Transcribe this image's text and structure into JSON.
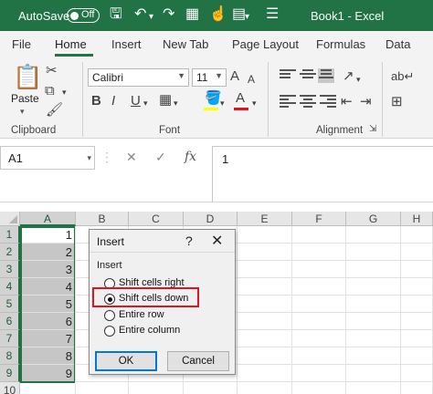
{
  "titlebar": {
    "autosave_label": "AutoSave",
    "autosave_state": "Off",
    "title": "Book1  -  Excel",
    "colors": {
      "bar": "#217346",
      "text": "#ffffff"
    }
  },
  "ribbon_tabs": [
    "File",
    "Home",
    "Insert",
    "New Tab",
    "Page Layout",
    "Formulas",
    "Data"
  ],
  "active_tab": "Home",
  "ribbon": {
    "clipboard": {
      "paste_label": "Paste",
      "group_label": "Clipboard"
    },
    "font": {
      "font_name": "Calibri",
      "font_size": "11",
      "group_label": "Font",
      "bold": "B",
      "italic": "I",
      "underline": "U",
      "grow": "A",
      "shrink": "A",
      "font_color": "A"
    },
    "alignment": {
      "group_label": "Alignment"
    }
  },
  "formula_bar": {
    "name_box": "A1",
    "cancel_symbol": "✕",
    "enter_symbol": "✓",
    "fx_symbol": "fx",
    "content": "1"
  },
  "grid": {
    "columns": [
      "A",
      "B",
      "C",
      "D",
      "E",
      "F",
      "G",
      "H"
    ],
    "rows": [
      "1",
      "2",
      "3",
      "4",
      "5",
      "6",
      "7",
      "8",
      "9",
      "10"
    ],
    "column_a_values": [
      "1",
      "2",
      "3",
      "4",
      "5",
      "6",
      "7",
      "8",
      "9"
    ],
    "selected_range": "A1:A9",
    "selection_color": "#217346"
  },
  "dialog": {
    "title": "Insert",
    "help": "?",
    "close": "✕",
    "section_label": "Insert",
    "options": [
      {
        "label": "Shift cells right",
        "checked": false
      },
      {
        "label": "Shift cells down",
        "checked": true
      },
      {
        "label": "Entire row",
        "checked": false
      },
      {
        "label": "Entire column",
        "checked": false
      }
    ],
    "ok_label": "OK",
    "cancel_label": "Cancel",
    "highlight_color": "#e0141e"
  }
}
